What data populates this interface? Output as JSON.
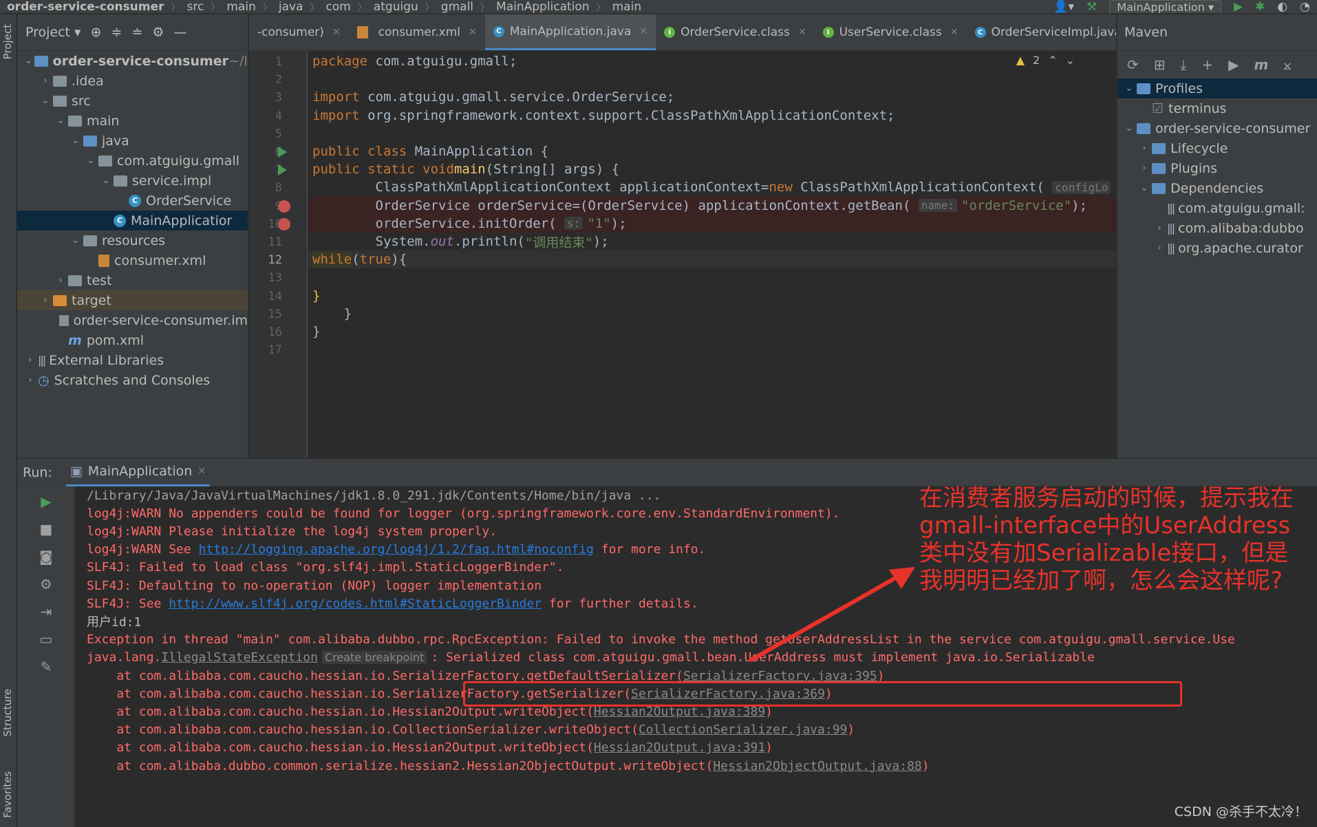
{
  "breadcrumb": [
    "order-service-consumer",
    "src",
    "main",
    "java",
    "com",
    "atguigu",
    "gmall",
    "MainApplication",
    "main"
  ],
  "run_config": "MainApplication",
  "left_strip": {
    "project": "Project",
    "structure": "Structure",
    "favorites": "Favorites"
  },
  "project_panel": {
    "title": "Project",
    "tree": [
      {
        "label": "order-service-consumer",
        "suffix": "~/I",
        "depth": 0,
        "arrow": "down",
        "icon": "module"
      },
      {
        "label": ".idea",
        "depth": 1,
        "arrow": "right",
        "icon": "folder"
      },
      {
        "label": "src",
        "depth": 1,
        "arrow": "down",
        "icon": "folder"
      },
      {
        "label": "main",
        "depth": 2,
        "arrow": "down",
        "icon": "folder"
      },
      {
        "label": "java",
        "depth": 3,
        "arrow": "down",
        "icon": "folder-blue"
      },
      {
        "label": "com.atguigu.gmall",
        "depth": 4,
        "arrow": "down",
        "icon": "package"
      },
      {
        "label": "service.impl",
        "depth": 5,
        "arrow": "down",
        "icon": "package"
      },
      {
        "label": "OrderService",
        "depth": 6,
        "arrow": "",
        "icon": "class"
      },
      {
        "label": "MainApplicatior",
        "depth": 5,
        "arrow": "",
        "icon": "class",
        "selected": true
      },
      {
        "label": "resources",
        "depth": 3,
        "arrow": "down",
        "icon": "folder"
      },
      {
        "label": "consumer.xml",
        "depth": 4,
        "arrow": "",
        "icon": "xml"
      },
      {
        "label": "test",
        "depth": 2,
        "arrow": "right",
        "icon": "folder"
      },
      {
        "label": "target",
        "depth": 1,
        "arrow": "right",
        "icon": "folder-orange",
        "target": true
      },
      {
        "label": "order-service-consumer.im",
        "depth": 2,
        "arrow": "",
        "icon": "file"
      },
      {
        "label": "pom.xml",
        "depth": 2,
        "arrow": "",
        "icon": "maven"
      },
      {
        "label": "External Libraries",
        "depth": 0,
        "arrow": "right",
        "icon": "lib"
      },
      {
        "label": "Scratches and Consoles",
        "depth": 0,
        "arrow": "right",
        "icon": "scratch"
      }
    ]
  },
  "tabs": [
    {
      "label": "-consumer)",
      "icon": "",
      "active": false
    },
    {
      "label": "consumer.xml",
      "icon": "xml",
      "active": false
    },
    {
      "label": "MainApplication.java",
      "icon": "class",
      "active": true
    },
    {
      "label": "OrderService.class",
      "icon": "interface",
      "active": false
    },
    {
      "label": "UserService.class",
      "icon": "interface",
      "active": false
    },
    {
      "label": "OrderServiceImpl.java",
      "icon": "class",
      "active": false
    }
  ],
  "warnings": "2",
  "code_lines": [
    {
      "n": "1",
      "html": "<span class='kw'>package</span> com.atguigu.gmall;"
    },
    {
      "n": "2",
      "html": ""
    },
    {
      "n": "3",
      "html": "<span class='kw'>import</span> com.atguigu.gmall.service.OrderService;"
    },
    {
      "n": "4",
      "html": "<span class='kw'>import</span> org.springframework.context.support.ClassPathXmlApplicationContext;"
    },
    {
      "n": "5",
      "html": ""
    },
    {
      "n": "6",
      "html": "<span class='kw'>public class</span> MainApplication {",
      "run": true
    },
    {
      "n": "7",
      "html": "    <span class='kw'>public static void</span> <span class='fn'>main</span>(String[] args) {",
      "run": true
    },
    {
      "n": "8",
      "html": "        ClassPathXmlApplicationContext applicationContext=<span class='kw'>new</span> ClassPathXmlApplicationContext( <span class='hint'>configLo</span>"
    },
    {
      "n": "9",
      "html": "        OrderService orderService=(OrderService) applicationContext.getBean( <span class='hint'>name:</span><span class='str'>\"orderService\"</span>);",
      "bp": true
    },
    {
      "n": "10",
      "html": "        orderService.initOrder( <span class='hint'>s:</span><span class='str'>\"1\"</span>);",
      "bp": true
    },
    {
      "n": "11",
      "html": "        System.<span class='st'>out</span>.println(<span class='str'>\"调用结束\"</span>);"
    },
    {
      "n": "12",
      "html": "        <span class='kw' style='background:#3b3a26'>while</span>(<span class='kw'>true</span>){",
      "cur": true
    },
    {
      "n": "13",
      "html": ""
    },
    {
      "n": "14",
      "html": "        <span style='color:#e0c341'>}</span>"
    },
    {
      "n": "15",
      "html": "    }"
    },
    {
      "n": "16",
      "html": "}"
    },
    {
      "n": "17",
      "html": ""
    }
  ],
  "maven": {
    "title": "Maven",
    "tree": [
      {
        "label": "Profiles",
        "depth": 0,
        "arrow": "down",
        "sel": true
      },
      {
        "label": "terminus",
        "depth": 1,
        "arrow": "",
        "check": true
      },
      {
        "label": "order-service-consumer",
        "depth": 0,
        "arrow": "down"
      },
      {
        "label": "Lifecycle",
        "depth": 1,
        "arrow": "right"
      },
      {
        "label": "Plugins",
        "depth": 1,
        "arrow": "right"
      },
      {
        "label": "Dependencies",
        "depth": 1,
        "arrow": "down"
      },
      {
        "label": "com.atguigu.gmall:",
        "depth": 2,
        "arrow": "",
        "lib": true
      },
      {
        "label": "com.alibaba:dubbo",
        "depth": 2,
        "arrow": "right",
        "lib": true
      },
      {
        "label": "org.apache.curator",
        "depth": 2,
        "arrow": "right",
        "lib": true
      }
    ]
  },
  "run_panel": {
    "label": "Run:",
    "tab": "MainApplication"
  },
  "console": [
    {
      "cls": "grey",
      "html": "/Library/Java/JavaVirtualMachines/jdk1.8.0_291.jdk/Contents/Home/bin/java ..."
    },
    {
      "cls": "",
      "html": "log4j:WARN No appenders could be found for logger (org.springframework.core.env.StandardEnvironment)."
    },
    {
      "cls": "",
      "html": "log4j:WARN Please initialize the log4j system properly."
    },
    {
      "cls": "",
      "html": "log4j:WARN See <span class='lnk'>http://logging.apache.org/log4j/1.2/faq.html#noconfig</span> for more info."
    },
    {
      "cls": "",
      "html": "SLF4J: Failed to load class \"org.slf4j.impl.StaticLoggerBinder\"."
    },
    {
      "cls": "",
      "html": "SLF4J: Defaulting to no-operation (NOP) logger implementation"
    },
    {
      "cls": "",
      "html": "SLF4J: See <span class='lnk'>http://www.slf4j.org/codes.html#StaticLoggerBinder</span> for further details."
    },
    {
      "cls": "white",
      "html": "用户id:1"
    },
    {
      "cls": "",
      "html": "Exception in thread \"main\" com.alibaba.dubbo.rpc.RpcException: Failed to invoke the method getUserAddressList in the service com.atguigu.gmall.service.Use"
    },
    {
      "cls": "",
      "html": "java.lang.<span class='lnk2'>IllegalStateException</span><span class='cbp'>Create breakpoint</span>: Serialized class com.atguigu.gmall.bean.UserAddress must implement java.io.Serializable"
    },
    {
      "cls": "",
      "html": "    at com.alibaba.com.caucho.hessian.io.SerializerFactory.getDefaultSerializer(<span class='lnk2'>SerializerFactory.java:395</span>)"
    },
    {
      "cls": "",
      "html": "    at com.alibaba.com.caucho.hessian.io.SerializerFactory.getSerializer(<span class='lnk2'>SerializerFactory.java:369</span>)"
    },
    {
      "cls": "",
      "html": "    at com.alibaba.com.caucho.hessian.io.Hessian2Output.writeObject(<span class='lnk2'>Hessian2Output.java:389</span>)"
    },
    {
      "cls": "",
      "html": "    at com.alibaba.com.caucho.hessian.io.CollectionSerializer.writeObject(<span class='lnk2'>CollectionSerializer.java:99</span>)"
    },
    {
      "cls": "",
      "html": "    at com.alibaba.com.caucho.hessian.io.Hessian2Output.writeObject(<span class='lnk2'>Hessian2Output.java:391</span>)"
    },
    {
      "cls": "",
      "html": "    at com.alibaba.dubbo.common.serialize.hessian2.Hessian2ObjectOutput.writeObject(<span class='lnk2'>Hessian2ObjectOutput.java:88</span>)"
    }
  ],
  "annotation": "在消费者服务启动的时候，提示我在gmall-interface中的UserAddress类中没有加Serializable接口，但是我明明已经加了啊，怎么会这样呢?",
  "watermark": "CSDN @杀手不太冷！",
  "colors": {
    "accent": "#4a88c7",
    "error": "#ff6b68",
    "annotation": "#e8322a"
  }
}
